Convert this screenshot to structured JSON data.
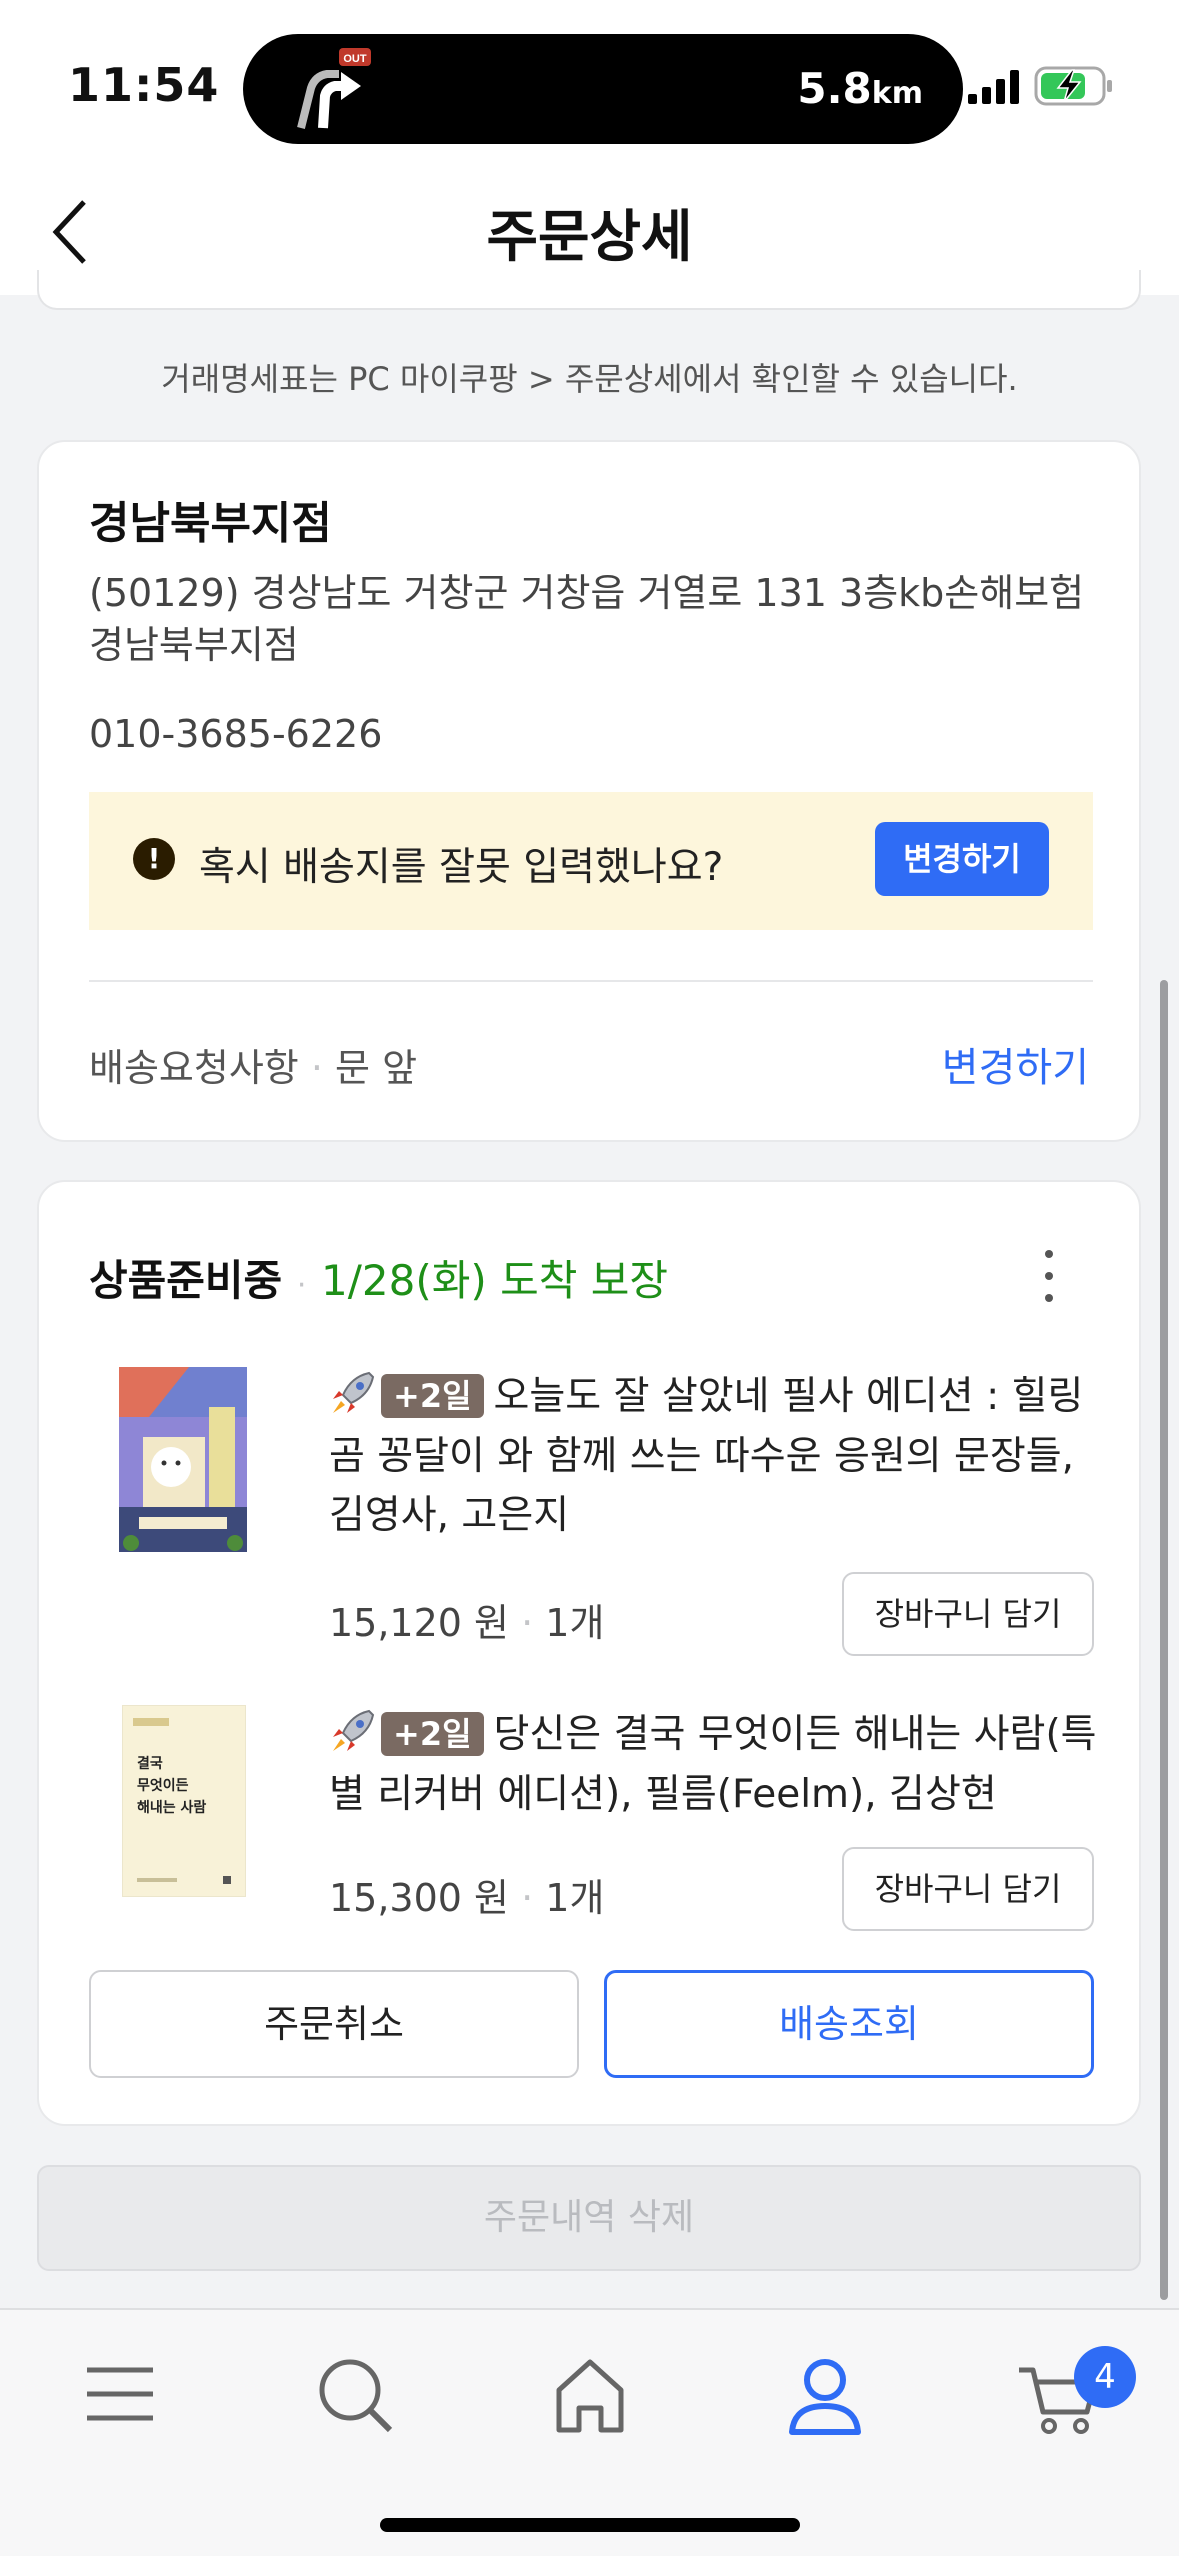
{
  "status_bar": {
    "time": "11:54",
    "distance_value": "5.8",
    "distance_unit": "km",
    "nav_badge": "OUT",
    "battery_color": "#34c759"
  },
  "header": {
    "title": "주문상세",
    "back_icon": "chevron-left-icon"
  },
  "notice": "거래명세표는 PC 마이쿠팡 > 주문상세에서 확인할 수 있습니다.",
  "address_card": {
    "name": "경남북부지점",
    "address": "(50129) 경상남도 거창군 거창읍 거열로 131 3층kb손해보험 경남북부지점",
    "phone": "010-3685-6226",
    "warning_text": "혹시 배송지를 잘못 입력했나요?",
    "warning_icon": "!",
    "change_button": "변경하기",
    "request_label": "배송요청사항",
    "request_separator": "·",
    "request_value": "문 앞",
    "request_change": "변경하기"
  },
  "order": {
    "status": "상품준비중",
    "separator": "·",
    "arrival": "1/28(화) 도착 보장",
    "items": [
      {
        "badge": "+2일",
        "title": "오늘도 잘 살았네 필사 에디션 : 힐링곰 꽁달이 와 함께 쓰는 따수운 응원의 문장들, 김영사, 고은지",
        "price": "15,120 원",
        "qty": "1개",
        "cart_button": "장바구니 담기"
      },
      {
        "badge": "+2일",
        "title": "당신은 결국 무엇이든 해내는 사람(특별 리커버 에디션), 필름(Feelm), 김상현",
        "price": "15,300 원",
        "qty": "1개",
        "cart_button": "장바구니 담기",
        "cover_text": "결국 무엇이든 해내는 사람"
      }
    ],
    "cancel_button": "주문취소",
    "track_button": "배송조회"
  },
  "delete_button": "주문내역 삭제",
  "tab_bar": {
    "cart_count": "4",
    "active_tab": "my-coupang",
    "accent": "#2f6cf5"
  }
}
